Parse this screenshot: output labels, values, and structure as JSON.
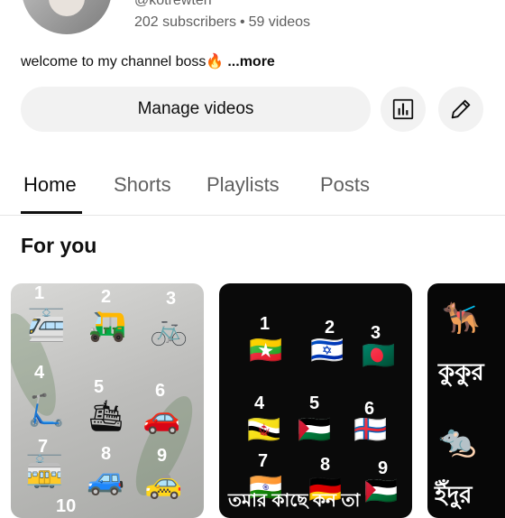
{
  "channel": {
    "handle": "@kotrewten",
    "subscribers": "202 subscribers",
    "separator": "•",
    "videos": "59 videos",
    "description": "welcome to my channel boss🔥",
    "more_label": "...more"
  },
  "actions": {
    "manage_label": "Manage videos",
    "analytics_icon": "bar-chart-icon",
    "edit_icon": "pencil-icon"
  },
  "tabs": [
    {
      "label": "Home",
      "active": true
    },
    {
      "label": "Shorts",
      "active": false
    },
    {
      "label": "Playlists",
      "active": false
    },
    {
      "label": "Posts",
      "active": false
    }
  ],
  "section": {
    "title": "For you"
  },
  "cards": [
    {
      "numbers": [
        "1",
        "2",
        "3",
        "4",
        "5",
        "6",
        "7",
        "8",
        "9",
        "10"
      ],
      "emojis": [
        "🚈",
        "🛺",
        "🚲",
        "🛴",
        "🛳",
        "🚗",
        "🚋",
        "🚙",
        "🚕"
      ]
    },
    {
      "numbers": [
        "1",
        "2",
        "3",
        "4",
        "5",
        "6",
        "7",
        "8",
        "9"
      ],
      "flags": [
        "🇲🇲",
        "🇮🇱",
        "🇧🇩",
        "🇧🇳",
        "🇵🇸",
        "🇫🇴",
        "🇮🇳",
        "🇩🇪",
        "🇵🇸"
      ],
      "caption": "তমার  কাছে কন তা"
    },
    {
      "emojis": [
        "🐕‍🦺",
        "🐀"
      ],
      "words": [
        "কুকুর",
        "ইঁদুর"
      ]
    }
  ],
  "colors": {
    "text_primary": "#0f0f0f",
    "text_secondary": "#606060",
    "chip_bg": "#f2f2f2"
  }
}
